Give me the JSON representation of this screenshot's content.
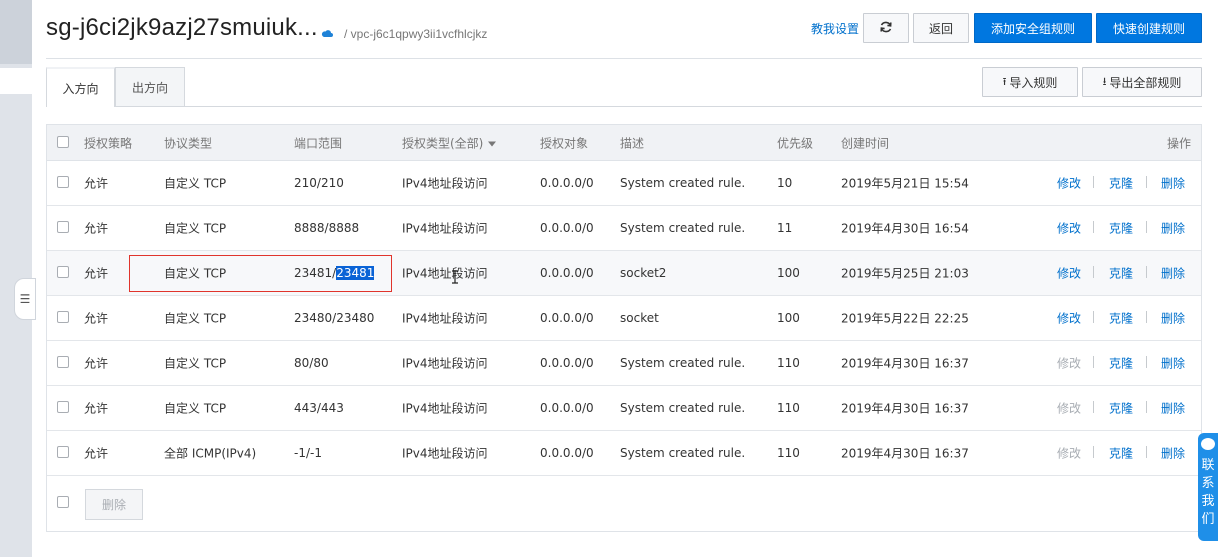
{
  "header": {
    "title": "sg-j6ci2jk9azj27smuiuk...",
    "vpc": "/ vpc-j6c1qpwy3ii1vcfhlcjkz",
    "help_link": "教我设置",
    "refresh_icon": "refresh-icon",
    "back_label": "返回",
    "add_rule_label": "添加安全组规则",
    "quick_create_label": "快速创建规则"
  },
  "tabs": [
    {
      "label": "入方向",
      "active": true
    },
    {
      "label": "出方向",
      "active": false
    }
  ],
  "toolbar": {
    "import_label": "导入规则",
    "export_label": "导出全部规则"
  },
  "table": {
    "columns": [
      "授权策略",
      "协议类型",
      "端口范围",
      "授权类型(全部)",
      "授权对象",
      "描述",
      "优先级",
      "创建时间",
      "操作"
    ],
    "rows": [
      {
        "policy": "允许",
        "protocol": "自定义 TCP",
        "port": "210/210",
        "auth_type": "IPv4地址段访问",
        "object": "0.0.0.0/0",
        "desc": "System created rule.",
        "priority": "10",
        "created": "2019年5月21日 15:54",
        "modify": "修改",
        "modify_enabled": true,
        "clone": "克隆",
        "delete": "删除"
      },
      {
        "policy": "允许",
        "protocol": "自定义 TCP",
        "port": "8888/8888",
        "auth_type": "IPv4地址段访问",
        "object": "0.0.0.0/0",
        "desc": "System created rule.",
        "priority": "11",
        "created": "2019年4月30日 16:54",
        "modify": "修改",
        "modify_enabled": true,
        "clone": "克隆",
        "delete": "删除"
      },
      {
        "policy": "允许",
        "protocol": "自定义 TCP",
        "port_prefix": "23481/",
        "port_selected": "23481",
        "auth_type": "IPv4地址段访问",
        "object": "0.0.0.0/0",
        "desc": "socket2",
        "priority": "100",
        "created": "2019年5月25日 21:03",
        "modify": "修改",
        "modify_enabled": true,
        "clone": "克隆",
        "delete": "删除"
      },
      {
        "policy": "允许",
        "protocol": "自定义 TCP",
        "port": "23480/23480",
        "auth_type": "IPv4地址段访问",
        "object": "0.0.0.0/0",
        "desc": "socket",
        "priority": "100",
        "created": "2019年5月22日 22:25",
        "modify": "修改",
        "modify_enabled": true,
        "clone": "克隆",
        "delete": "删除"
      },
      {
        "policy": "允许",
        "protocol": "自定义 TCP",
        "port": "80/80",
        "auth_type": "IPv4地址段访问",
        "object": "0.0.0.0/0",
        "desc": "System created rule.",
        "priority": "110",
        "created": "2019年4月30日 16:37",
        "modify": "修改",
        "modify_enabled": false,
        "clone": "克隆",
        "delete": "删除"
      },
      {
        "policy": "允许",
        "protocol": "自定义 TCP",
        "port": "443/443",
        "auth_type": "IPv4地址段访问",
        "object": "0.0.0.0/0",
        "desc": "System created rule.",
        "priority": "110",
        "created": "2019年4月30日 16:37",
        "modify": "修改",
        "modify_enabled": false,
        "clone": "克隆",
        "delete": "删除"
      },
      {
        "policy": "允许",
        "protocol": "全部 ICMP(IPv4)",
        "port": "-1/-1",
        "auth_type": "IPv4地址段访问",
        "object": "0.0.0.0/0",
        "desc": "System created rule.",
        "priority": "110",
        "created": "2019年4月30日 16:37",
        "modify": "修改",
        "modify_enabled": false,
        "clone": "克隆",
        "delete": "删除"
      }
    ],
    "bulk_delete_label": "删除"
  },
  "contact_widget": {
    "chars": [
      "联",
      "系",
      "我",
      "们"
    ]
  },
  "colors": {
    "primary": "#0077e0",
    "link": "#0070cc",
    "highlight_border": "#e0342c",
    "selection": "#0a63d6"
  }
}
